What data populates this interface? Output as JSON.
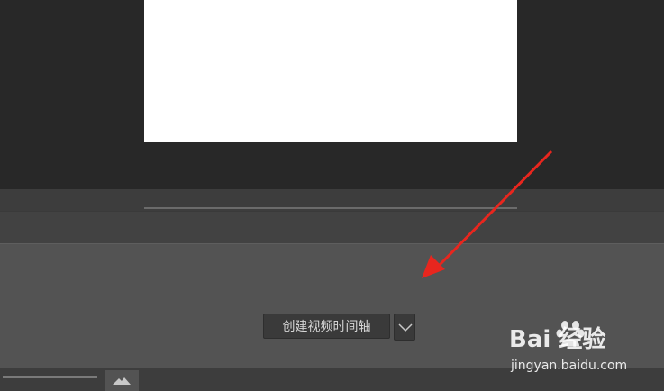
{
  "timeline": {
    "create_button_label": "创建视频时间轴"
  },
  "watermark": {
    "brand": "Bai 经验",
    "url": "jingyan.baidu.com"
  },
  "colors": {
    "canvas_bg": "#282828",
    "panel_bg": "#535353",
    "annotation_arrow": "#e8261e"
  },
  "icons": [
    "chevron-down-icon",
    "mountain-icon",
    "baidu-paw-icon",
    "annotation-arrow"
  ]
}
